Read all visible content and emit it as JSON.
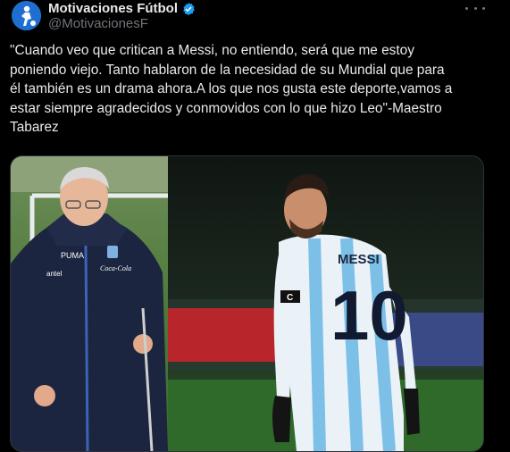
{
  "account": {
    "display_name": "Motivaciones Fútbol",
    "handle": "@MotivacionesF",
    "avatar_icon": "soccer-player-logo-icon",
    "verified_icon": "verified-badge-icon",
    "verified_color": "#1d9bf0"
  },
  "more_icon": "more-dots-icon",
  "tweet": {
    "text": "\"Cuando veo que critican a Messi, no entiendo, será que me estoy\nponiendo viejo. Tanto hablaron de la necesidad de su Mundial que para\nél también es un drama ahora.A los que nos gusta este deporte,vamos a\nestar siempre agradecidos y conmovidos con lo que hizo Leo\"-Maestro\nTabarez"
  },
  "media": {
    "left_photo": {
      "jacket_brand": "PUMA",
      "sponsor_1": "antel",
      "sponsor_2": "Coca-Cola"
    },
    "right_photo": {
      "shirt_name": "MESSI",
      "shirt_number": "10",
      "armband": "C"
    }
  }
}
